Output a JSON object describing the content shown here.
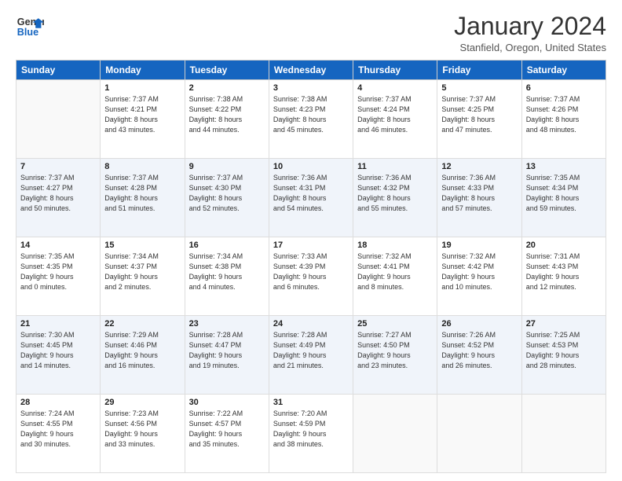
{
  "header": {
    "logo_line1": "General",
    "logo_line2": "Blue",
    "month_title": "January 2024",
    "location": "Stanfield, Oregon, United States"
  },
  "days_of_week": [
    "Sunday",
    "Monday",
    "Tuesday",
    "Wednesday",
    "Thursday",
    "Friday",
    "Saturday"
  ],
  "weeks": [
    [
      {
        "day": "",
        "info": ""
      },
      {
        "day": "1",
        "info": "Sunrise: 7:37 AM\nSunset: 4:21 PM\nDaylight: 8 hours\nand 43 minutes."
      },
      {
        "day": "2",
        "info": "Sunrise: 7:38 AM\nSunset: 4:22 PM\nDaylight: 8 hours\nand 44 minutes."
      },
      {
        "day": "3",
        "info": "Sunrise: 7:38 AM\nSunset: 4:23 PM\nDaylight: 8 hours\nand 45 minutes."
      },
      {
        "day": "4",
        "info": "Sunrise: 7:37 AM\nSunset: 4:24 PM\nDaylight: 8 hours\nand 46 minutes."
      },
      {
        "day": "5",
        "info": "Sunrise: 7:37 AM\nSunset: 4:25 PM\nDaylight: 8 hours\nand 47 minutes."
      },
      {
        "day": "6",
        "info": "Sunrise: 7:37 AM\nSunset: 4:26 PM\nDaylight: 8 hours\nand 48 minutes."
      }
    ],
    [
      {
        "day": "7",
        "info": "Sunrise: 7:37 AM\nSunset: 4:27 PM\nDaylight: 8 hours\nand 50 minutes."
      },
      {
        "day": "8",
        "info": "Sunrise: 7:37 AM\nSunset: 4:28 PM\nDaylight: 8 hours\nand 51 minutes."
      },
      {
        "day": "9",
        "info": "Sunrise: 7:37 AM\nSunset: 4:30 PM\nDaylight: 8 hours\nand 52 minutes."
      },
      {
        "day": "10",
        "info": "Sunrise: 7:36 AM\nSunset: 4:31 PM\nDaylight: 8 hours\nand 54 minutes."
      },
      {
        "day": "11",
        "info": "Sunrise: 7:36 AM\nSunset: 4:32 PM\nDaylight: 8 hours\nand 55 minutes."
      },
      {
        "day": "12",
        "info": "Sunrise: 7:36 AM\nSunset: 4:33 PM\nDaylight: 8 hours\nand 57 minutes."
      },
      {
        "day": "13",
        "info": "Sunrise: 7:35 AM\nSunset: 4:34 PM\nDaylight: 8 hours\nand 59 minutes."
      }
    ],
    [
      {
        "day": "14",
        "info": "Sunrise: 7:35 AM\nSunset: 4:35 PM\nDaylight: 9 hours\nand 0 minutes."
      },
      {
        "day": "15",
        "info": "Sunrise: 7:34 AM\nSunset: 4:37 PM\nDaylight: 9 hours\nand 2 minutes."
      },
      {
        "day": "16",
        "info": "Sunrise: 7:34 AM\nSunset: 4:38 PM\nDaylight: 9 hours\nand 4 minutes."
      },
      {
        "day": "17",
        "info": "Sunrise: 7:33 AM\nSunset: 4:39 PM\nDaylight: 9 hours\nand 6 minutes."
      },
      {
        "day": "18",
        "info": "Sunrise: 7:32 AM\nSunset: 4:41 PM\nDaylight: 9 hours\nand 8 minutes."
      },
      {
        "day": "19",
        "info": "Sunrise: 7:32 AM\nSunset: 4:42 PM\nDaylight: 9 hours\nand 10 minutes."
      },
      {
        "day": "20",
        "info": "Sunrise: 7:31 AM\nSunset: 4:43 PM\nDaylight: 9 hours\nand 12 minutes."
      }
    ],
    [
      {
        "day": "21",
        "info": "Sunrise: 7:30 AM\nSunset: 4:45 PM\nDaylight: 9 hours\nand 14 minutes."
      },
      {
        "day": "22",
        "info": "Sunrise: 7:29 AM\nSunset: 4:46 PM\nDaylight: 9 hours\nand 16 minutes."
      },
      {
        "day": "23",
        "info": "Sunrise: 7:28 AM\nSunset: 4:47 PM\nDaylight: 9 hours\nand 19 minutes."
      },
      {
        "day": "24",
        "info": "Sunrise: 7:28 AM\nSunset: 4:49 PM\nDaylight: 9 hours\nand 21 minutes."
      },
      {
        "day": "25",
        "info": "Sunrise: 7:27 AM\nSunset: 4:50 PM\nDaylight: 9 hours\nand 23 minutes."
      },
      {
        "day": "26",
        "info": "Sunrise: 7:26 AM\nSunset: 4:52 PM\nDaylight: 9 hours\nand 26 minutes."
      },
      {
        "day": "27",
        "info": "Sunrise: 7:25 AM\nSunset: 4:53 PM\nDaylight: 9 hours\nand 28 minutes."
      }
    ],
    [
      {
        "day": "28",
        "info": "Sunrise: 7:24 AM\nSunset: 4:55 PM\nDaylight: 9 hours\nand 30 minutes."
      },
      {
        "day": "29",
        "info": "Sunrise: 7:23 AM\nSunset: 4:56 PM\nDaylight: 9 hours\nand 33 minutes."
      },
      {
        "day": "30",
        "info": "Sunrise: 7:22 AM\nSunset: 4:57 PM\nDaylight: 9 hours\nand 35 minutes."
      },
      {
        "day": "31",
        "info": "Sunrise: 7:20 AM\nSunset: 4:59 PM\nDaylight: 9 hours\nand 38 minutes."
      },
      {
        "day": "",
        "info": ""
      },
      {
        "day": "",
        "info": ""
      },
      {
        "day": "",
        "info": ""
      }
    ]
  ]
}
